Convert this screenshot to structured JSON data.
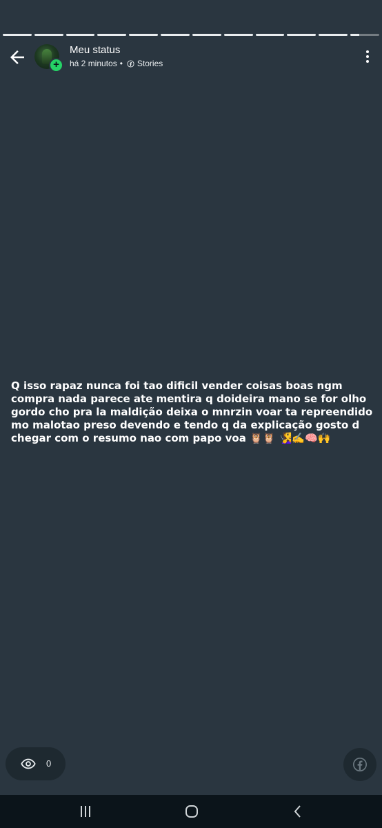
{
  "header": {
    "title": "Meu status",
    "time": "há 2 minutos",
    "separator": "•",
    "source": "Stories"
  },
  "progress": {
    "segments": 12,
    "completed": 11,
    "current_fraction": 0.3
  },
  "status": {
    "text": "Q isso rapaz nunca foi tao dificil vender coisas boas ngm compra nada parece ate mentira q doideira mano se for olho gordo cho pra la maldição deixa o mnrzin voar ta repreendido mo malotao preso devendo e tendo q da explicação gosto d chegar com o resumo nao com papo voa 🦉🦉 🧏‍♀️✍️🧠🙌"
  },
  "footer": {
    "views_count": "0"
  },
  "colors": {
    "background": "#2a3640",
    "accent_green": "#25d366",
    "pill_background": "#1e2930",
    "navbar": "#0b141a"
  },
  "icons": {
    "back": "arrow-left-icon",
    "menu": "more-vertical-icon",
    "views": "eye-icon",
    "share": "facebook-icon",
    "nav_recents": "recent-apps-icon",
    "nav_home": "home-icon",
    "nav_back": "nav-back-icon"
  }
}
